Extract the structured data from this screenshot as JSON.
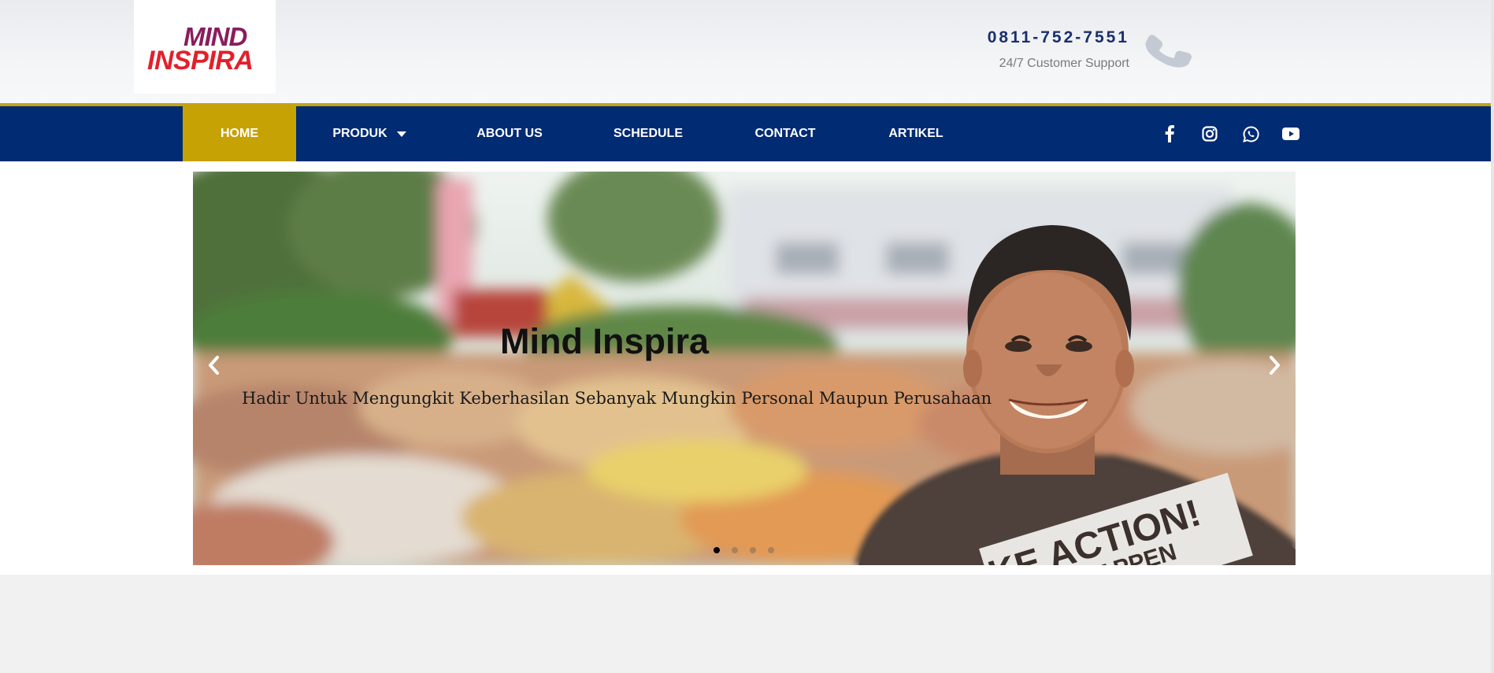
{
  "logo": {
    "line1": "MIND",
    "line2": "INSPIRA"
  },
  "contact": {
    "phone": "0811-752-7551",
    "support": "24/7 Customer Support",
    "icon": "phone-icon"
  },
  "nav": {
    "items": [
      {
        "label": "HOME",
        "active": true
      },
      {
        "label": "PRODUK",
        "dropdown": true
      },
      {
        "label": "ABOUT US"
      },
      {
        "label": "SCHEDULE"
      },
      {
        "label": "CONTACT"
      },
      {
        "label": "ARTIKEL"
      }
    ],
    "social": [
      "facebook-icon",
      "instagram-icon",
      "whatsapp-icon",
      "youtube-icon"
    ]
  },
  "slider": {
    "title": "Mind Inspira",
    "subtitle": "Hadir Untuk Mengungkit Keberhasilan Sebanyak Mungkin Personal Maupun Perusahaan",
    "shirt_text_1": "KE ACTION!",
    "shirt_text_2": "IT HAPPEN",
    "slides": 4,
    "active": 1
  },
  "colors": {
    "nav": "#012b73",
    "accent": "#c6a205",
    "logo_purple": "#8a1d5c",
    "logo_red": "#e2202b"
  }
}
